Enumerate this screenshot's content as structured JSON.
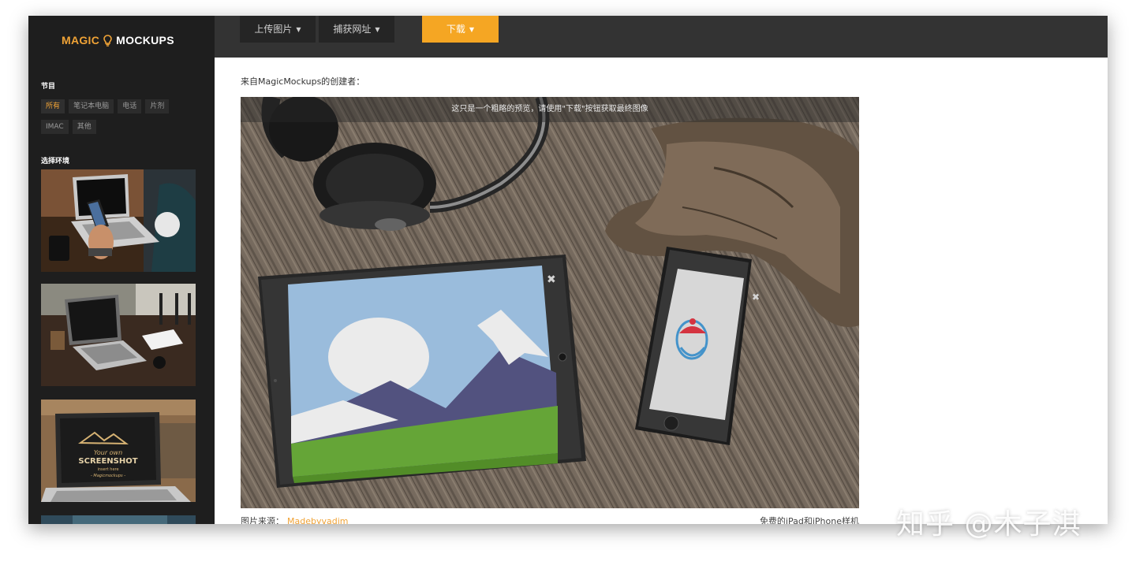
{
  "app": {
    "logo_left": "MAGIC",
    "logo_right": "MOCKUPS"
  },
  "sidebar": {
    "categories_heading": "节目",
    "filters": [
      "所有",
      "笔记本电脑",
      "电话",
      "片剂",
      "IMAC",
      "其他"
    ],
    "active_filter": "所有",
    "env_heading": "选择环境",
    "thumbnails": [
      {
        "scene": "laptop-phone-hand",
        "icon": "laptop-icon"
      },
      {
        "scene": "laptop-cafe",
        "icon": "laptop-icon"
      },
      {
        "scene": "laptop-screenshot",
        "icon": "laptop-icon",
        "screen_text": [
          "Your own",
          "SCREENSHOT",
          "insert here",
          "- Magicmockups -"
        ]
      },
      {
        "scene": "partial",
        "icon": "image-icon"
      }
    ]
  },
  "nav": {
    "upload": "上传图片",
    "capture": "捕获网址",
    "download": "下载"
  },
  "main": {
    "creator_text": "来自MagicMockups的创建者：",
    "preview_banner": "这只是一个粗略的预览，请使用\"下载\"按钮获取最终图像",
    "source_label": "图片来源：",
    "source_link": "Madebyvadim",
    "free_text": "免费的iPad和iPhone样机"
  },
  "watermark": "知乎 @木子淇",
  "colors": {
    "accent": "#f5a623",
    "sidebar_bg": "#1e1e1e",
    "topbar_bg": "#333333"
  }
}
